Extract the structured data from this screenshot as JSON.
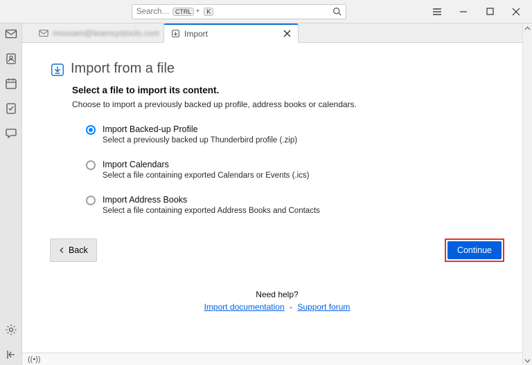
{
  "toolbar": {
    "search_placeholder": "Search…",
    "kbd1": "CTRL",
    "kbd_plus": "+",
    "kbd2": "K"
  },
  "tabs": {
    "account": "mousam@teamsystools.com",
    "import": "Import"
  },
  "page": {
    "title": "Import from a file",
    "subtitle": "Select a file to import its content.",
    "description": "Choose to import a previously backed up profile, address books or calendars."
  },
  "options": [
    {
      "label": "Import Backed-up Profile",
      "desc": "Select a previously backed up Thunderbird profile (.zip)",
      "selected": true
    },
    {
      "label": "Import Calendars",
      "desc": "Select a file containing exported Calendars or Events (.ics)",
      "selected": false
    },
    {
      "label": "Import Address Books",
      "desc": "Select a file containing exported Address Books and Contacts",
      "selected": false
    }
  ],
  "buttons": {
    "back": "Back",
    "continue": "Continue"
  },
  "help": {
    "need": "Need help?",
    "doc": "Import documentation",
    "sep": "-",
    "forum": "Support forum"
  },
  "status": {
    "signal": "((•))"
  }
}
